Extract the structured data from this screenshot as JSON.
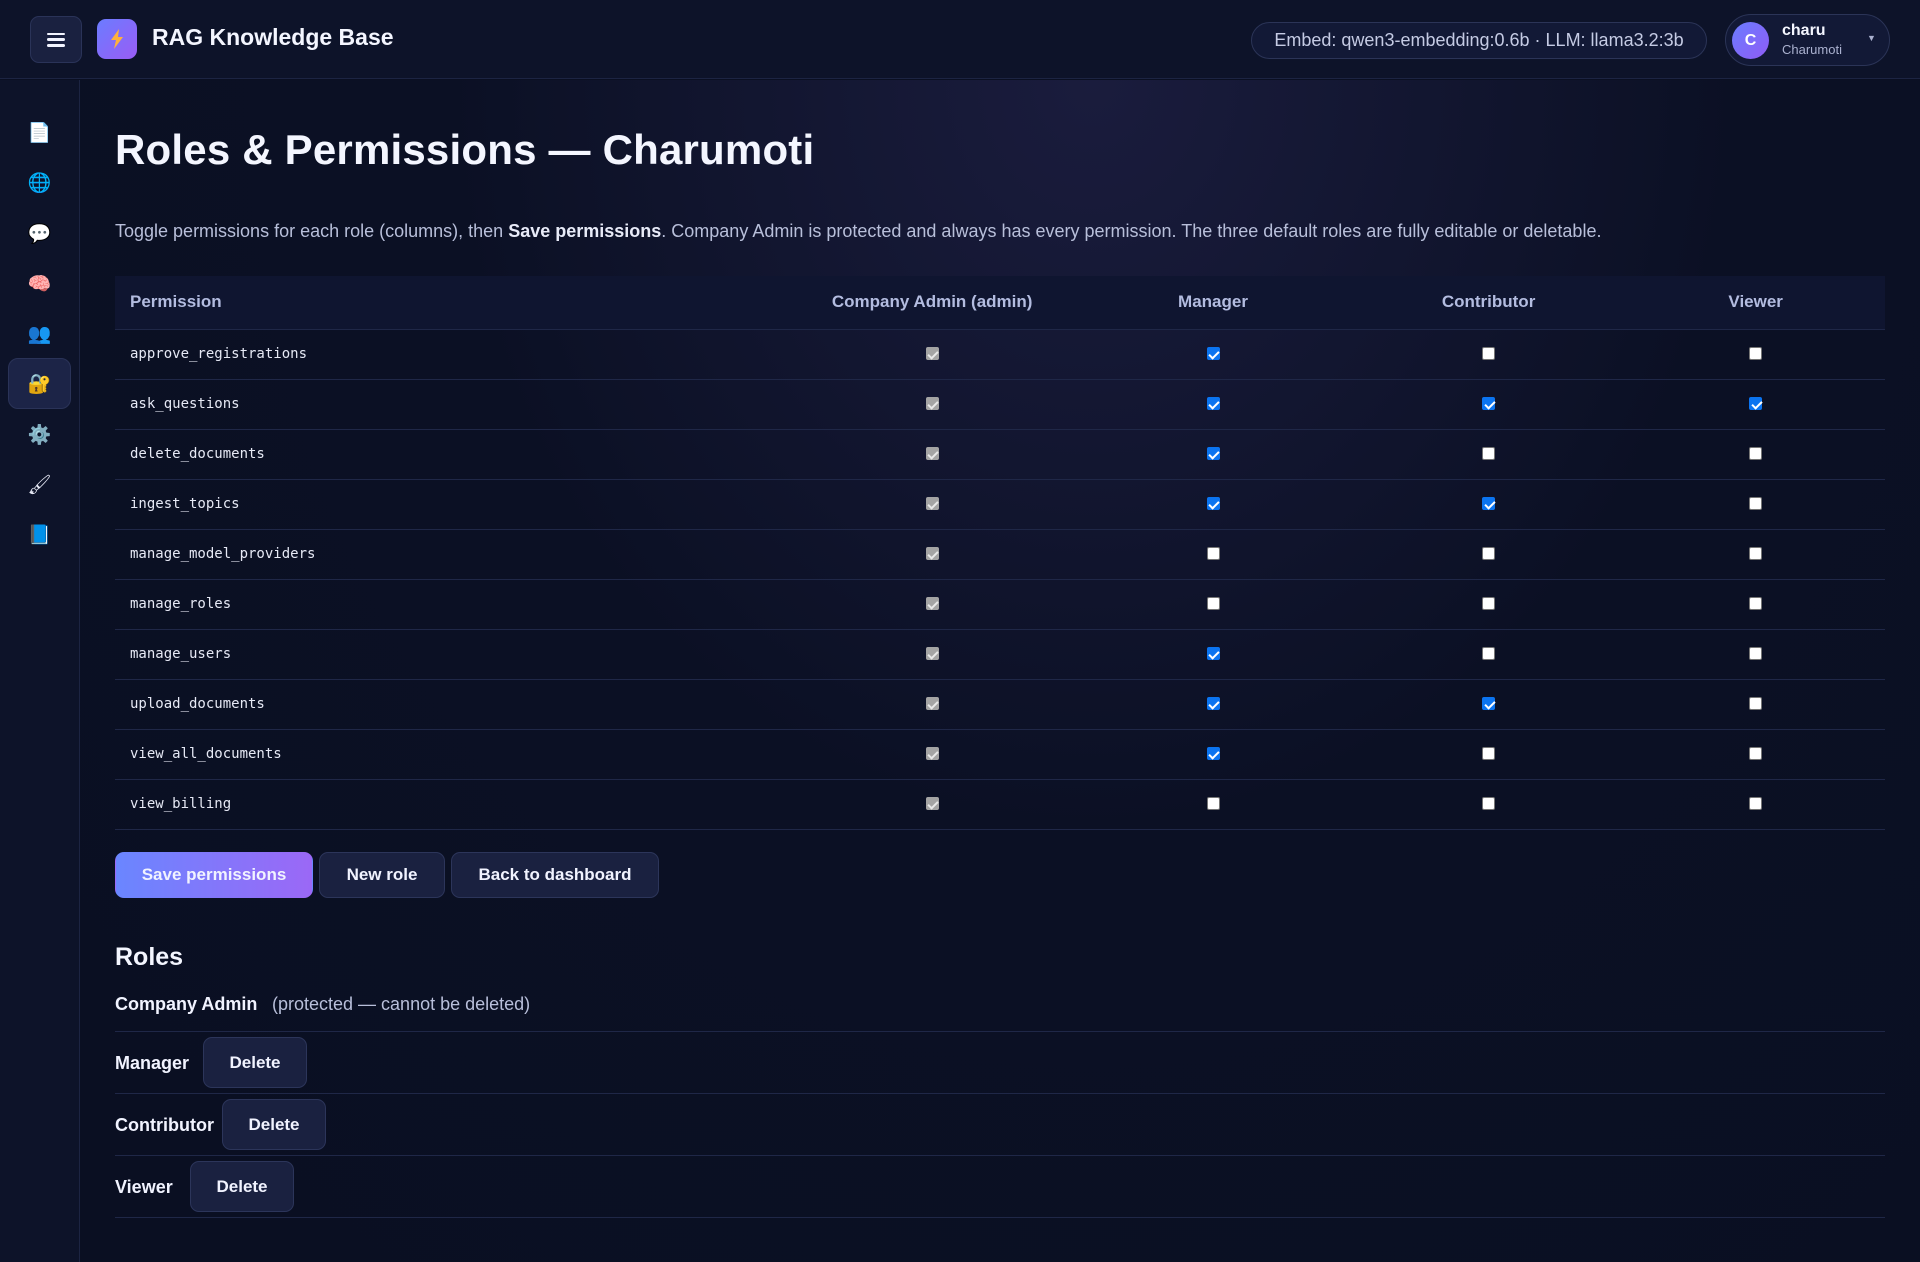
{
  "header": {
    "app_title": "RAG Knowledge Base",
    "model_info": "Embed: qwen3-embedding:0.6b · LLM: llama3.2:3b",
    "user": {
      "initial": "C",
      "name": "charu",
      "org": "Charumoti"
    }
  },
  "sidebar": {
    "items": [
      {
        "icon": "document-icon",
        "glyph": "📄",
        "active": false
      },
      {
        "icon": "globe-icon",
        "glyph": "🌐",
        "active": false
      },
      {
        "icon": "chat-icon",
        "glyph": "💬",
        "active": false
      },
      {
        "icon": "brain-icon",
        "glyph": "🧠",
        "active": false
      },
      {
        "icon": "users-icon",
        "glyph": "👥",
        "active": false
      },
      {
        "icon": "lock-icon",
        "glyph": "🔐",
        "active": true
      },
      {
        "icon": "gear-icon",
        "glyph": "⚙️",
        "active": false
      },
      {
        "icon": "brush-icon",
        "glyph": "🖌",
        "active": false
      },
      {
        "icon": "book-icon",
        "glyph": "📘",
        "active": false
      }
    ]
  },
  "page": {
    "title": "Roles & Permissions — Charumoti",
    "intro_before": "Toggle permissions for each role (columns), then ",
    "intro_bold": "Save permissions",
    "intro_after": ". Company Admin is protected and always has every permission. The three default roles are fully editable or deletable."
  },
  "table": {
    "headers": [
      "Permission",
      "Company Admin (admin)",
      "Manager",
      "Contributor",
      "Viewer"
    ],
    "rows": [
      {
        "permission": "approve_registrations",
        "admin": true,
        "manager": true,
        "contributor": false,
        "viewer": false
      },
      {
        "permission": "ask_questions",
        "admin": true,
        "manager": true,
        "contributor": true,
        "viewer": true
      },
      {
        "permission": "delete_documents",
        "admin": true,
        "manager": true,
        "contributor": false,
        "viewer": false
      },
      {
        "permission": "ingest_topics",
        "admin": true,
        "manager": true,
        "contributor": true,
        "viewer": false
      },
      {
        "permission": "manage_model_providers",
        "admin": true,
        "manager": false,
        "contributor": false,
        "viewer": false
      },
      {
        "permission": "manage_roles",
        "admin": true,
        "manager": false,
        "contributor": false,
        "viewer": false
      },
      {
        "permission": "manage_users",
        "admin": true,
        "manager": true,
        "contributor": false,
        "viewer": false
      },
      {
        "permission": "upload_documents",
        "admin": true,
        "manager": true,
        "contributor": true,
        "viewer": false
      },
      {
        "permission": "view_all_documents",
        "admin": true,
        "manager": true,
        "contributor": false,
        "viewer": false
      },
      {
        "permission": "view_billing",
        "admin": true,
        "manager": false,
        "contributor": false,
        "viewer": false
      }
    ]
  },
  "actions": {
    "save": "Save permissions",
    "new_role": "New role",
    "back": "Back to dashboard"
  },
  "roles": {
    "title": "Roles",
    "admin_name": "Company Admin",
    "admin_note": "(protected — cannot be deleted)",
    "delete_label": "Delete",
    "list": [
      "Manager",
      "Contributor",
      "Viewer"
    ]
  }
}
